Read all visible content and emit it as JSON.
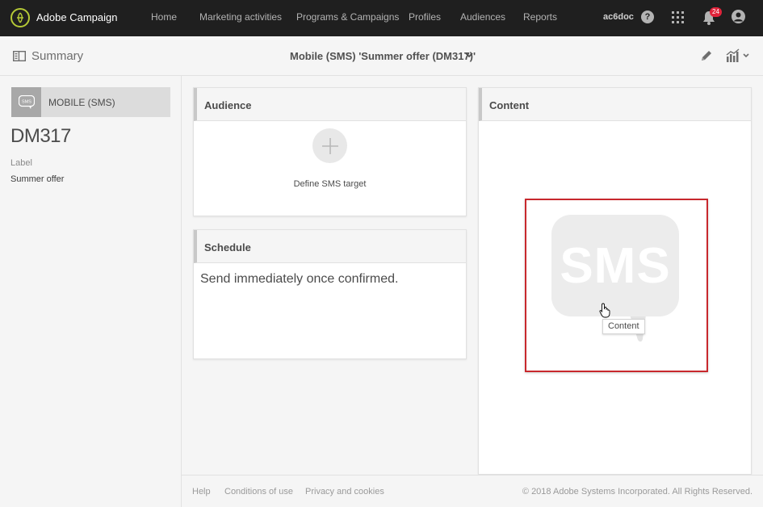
{
  "header": {
    "app_title": "Adobe Campaign",
    "nav": [
      "Home",
      "Marketing activities",
      "Programs & Campaigns",
      "Profiles",
      "Audiences",
      "Reports"
    ],
    "username": "ac6doc",
    "help_glyph": "?",
    "notification_count": "24",
    "colors": {
      "bar": "#1f1f1f",
      "logo": "#b5c936",
      "badge": "#e0233a"
    }
  },
  "subheader": {
    "summary_label": "Summary",
    "page_title": "Mobile (SMS) 'Summer offer (DM317)'"
  },
  "left": {
    "channel_icon_text": "SMS",
    "channel_label": "MOBILE (SMS)",
    "code": "DM317",
    "label_caption": "Label",
    "label_value": "Summer offer"
  },
  "audience": {
    "title": "Audience",
    "add_glyph": "+",
    "define_target": "Define SMS target"
  },
  "schedule": {
    "title": "Schedule",
    "text": "Send immediately once confirmed."
  },
  "content": {
    "title": "Content",
    "sms_label": "SMS",
    "tooltip": "Content",
    "highlight_color": "#c8282d"
  },
  "footer": {
    "links": [
      "Help",
      "Conditions of use",
      "Privacy and cookies"
    ],
    "copyright": "© 2018 Adobe Systems Incorporated. All Rights Reserved."
  }
}
